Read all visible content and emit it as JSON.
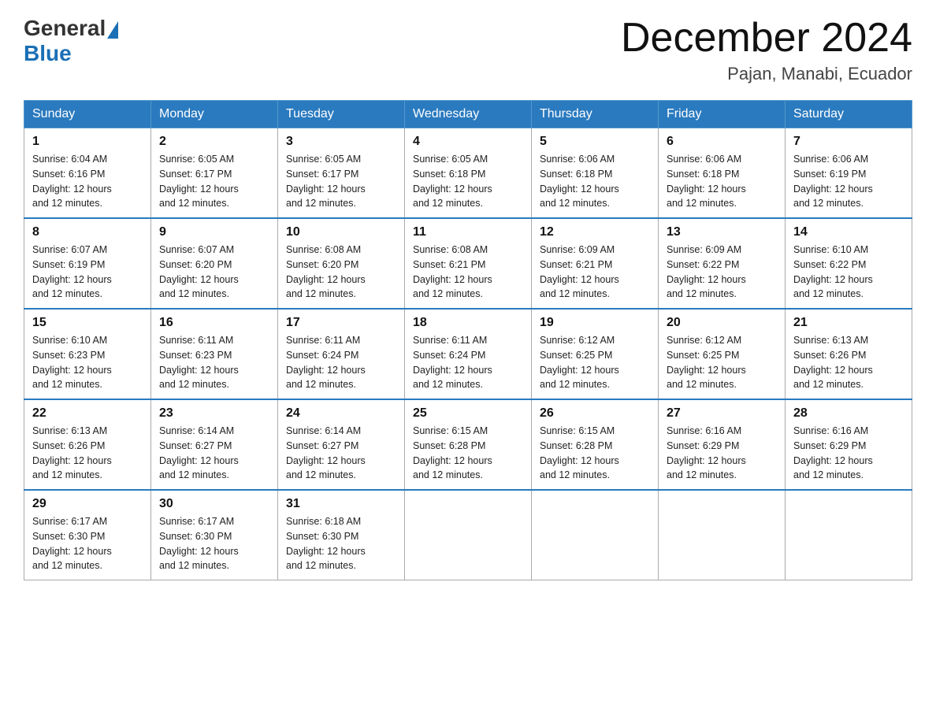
{
  "header": {
    "logo_general": "General",
    "logo_blue": "Blue",
    "month": "December 2024",
    "location": "Pajan, Manabi, Ecuador"
  },
  "weekdays": [
    "Sunday",
    "Monday",
    "Tuesday",
    "Wednesday",
    "Thursday",
    "Friday",
    "Saturday"
  ],
  "weeks": [
    [
      {
        "day": "1",
        "sunrise": "6:04 AM",
        "sunset": "6:16 PM",
        "daylight": "12 hours and 12 minutes."
      },
      {
        "day": "2",
        "sunrise": "6:05 AM",
        "sunset": "6:17 PM",
        "daylight": "12 hours and 12 minutes."
      },
      {
        "day": "3",
        "sunrise": "6:05 AM",
        "sunset": "6:17 PM",
        "daylight": "12 hours and 12 minutes."
      },
      {
        "day": "4",
        "sunrise": "6:05 AM",
        "sunset": "6:18 PM",
        "daylight": "12 hours and 12 minutes."
      },
      {
        "day": "5",
        "sunrise": "6:06 AM",
        "sunset": "6:18 PM",
        "daylight": "12 hours and 12 minutes."
      },
      {
        "day": "6",
        "sunrise": "6:06 AM",
        "sunset": "6:18 PM",
        "daylight": "12 hours and 12 minutes."
      },
      {
        "day": "7",
        "sunrise": "6:06 AM",
        "sunset": "6:19 PM",
        "daylight": "12 hours and 12 minutes."
      }
    ],
    [
      {
        "day": "8",
        "sunrise": "6:07 AM",
        "sunset": "6:19 PM",
        "daylight": "12 hours and 12 minutes."
      },
      {
        "day": "9",
        "sunrise": "6:07 AM",
        "sunset": "6:20 PM",
        "daylight": "12 hours and 12 minutes."
      },
      {
        "day": "10",
        "sunrise": "6:08 AM",
        "sunset": "6:20 PM",
        "daylight": "12 hours and 12 minutes."
      },
      {
        "day": "11",
        "sunrise": "6:08 AM",
        "sunset": "6:21 PM",
        "daylight": "12 hours and 12 minutes."
      },
      {
        "day": "12",
        "sunrise": "6:09 AM",
        "sunset": "6:21 PM",
        "daylight": "12 hours and 12 minutes."
      },
      {
        "day": "13",
        "sunrise": "6:09 AM",
        "sunset": "6:22 PM",
        "daylight": "12 hours and 12 minutes."
      },
      {
        "day": "14",
        "sunrise": "6:10 AM",
        "sunset": "6:22 PM",
        "daylight": "12 hours and 12 minutes."
      }
    ],
    [
      {
        "day": "15",
        "sunrise": "6:10 AM",
        "sunset": "6:23 PM",
        "daylight": "12 hours and 12 minutes."
      },
      {
        "day": "16",
        "sunrise": "6:11 AM",
        "sunset": "6:23 PM",
        "daylight": "12 hours and 12 minutes."
      },
      {
        "day": "17",
        "sunrise": "6:11 AM",
        "sunset": "6:24 PM",
        "daylight": "12 hours and 12 minutes."
      },
      {
        "day": "18",
        "sunrise": "6:11 AM",
        "sunset": "6:24 PM",
        "daylight": "12 hours and 12 minutes."
      },
      {
        "day": "19",
        "sunrise": "6:12 AM",
        "sunset": "6:25 PM",
        "daylight": "12 hours and 12 minutes."
      },
      {
        "day": "20",
        "sunrise": "6:12 AM",
        "sunset": "6:25 PM",
        "daylight": "12 hours and 12 minutes."
      },
      {
        "day": "21",
        "sunrise": "6:13 AM",
        "sunset": "6:26 PM",
        "daylight": "12 hours and 12 minutes."
      }
    ],
    [
      {
        "day": "22",
        "sunrise": "6:13 AM",
        "sunset": "6:26 PM",
        "daylight": "12 hours and 12 minutes."
      },
      {
        "day": "23",
        "sunrise": "6:14 AM",
        "sunset": "6:27 PM",
        "daylight": "12 hours and 12 minutes."
      },
      {
        "day": "24",
        "sunrise": "6:14 AM",
        "sunset": "6:27 PM",
        "daylight": "12 hours and 12 minutes."
      },
      {
        "day": "25",
        "sunrise": "6:15 AM",
        "sunset": "6:28 PM",
        "daylight": "12 hours and 12 minutes."
      },
      {
        "day": "26",
        "sunrise": "6:15 AM",
        "sunset": "6:28 PM",
        "daylight": "12 hours and 12 minutes."
      },
      {
        "day": "27",
        "sunrise": "6:16 AM",
        "sunset": "6:29 PM",
        "daylight": "12 hours and 12 minutes."
      },
      {
        "day": "28",
        "sunrise": "6:16 AM",
        "sunset": "6:29 PM",
        "daylight": "12 hours and 12 minutes."
      }
    ],
    [
      {
        "day": "29",
        "sunrise": "6:17 AM",
        "sunset": "6:30 PM",
        "daylight": "12 hours and 12 minutes."
      },
      {
        "day": "30",
        "sunrise": "6:17 AM",
        "sunset": "6:30 PM",
        "daylight": "12 hours and 12 minutes."
      },
      {
        "day": "31",
        "sunrise": "6:18 AM",
        "sunset": "6:30 PM",
        "daylight": "12 hours and 12 minutes."
      },
      null,
      null,
      null,
      null
    ]
  ],
  "labels": {
    "sunrise": "Sunrise:",
    "sunset": "Sunset:",
    "daylight": "Daylight:"
  }
}
